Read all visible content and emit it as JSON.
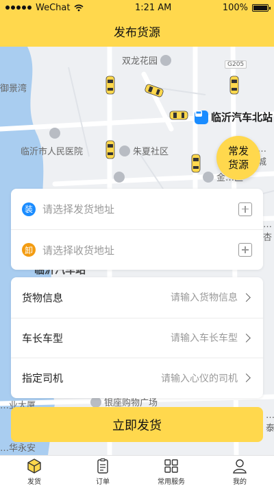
{
  "status": {
    "carrier": "WeChat",
    "time": "1:21 AM",
    "battery": "100%"
  },
  "header": {
    "title": "发布货源"
  },
  "map": {
    "pois": {
      "shuanglong": "双龙花园",
      "yujingwan": "御景湾",
      "hospital": "临沂市人民医院",
      "zhuxia": "朱夏社区",
      "jinqu": "金…区",
      "right_edge": "…城",
      "right_edge2": "…杏",
      "mall": "银座购物广场",
      "industry": "…业大厦",
      "huayongan": "…华永安",
      "tai": "…泰"
    },
    "station": "临沂汽车北站",
    "station_obscured": "临沂汽车站",
    "road": "G205"
  },
  "fab": {
    "line1": "常发",
    "line2": "货源"
  },
  "address": {
    "load_badge": "装",
    "load_placeholder": "请选择发货地址",
    "unload_badge": "卸",
    "unload_placeholder": "请选择收货地址"
  },
  "info": {
    "goods": {
      "label": "货物信息",
      "placeholder": "请输入货物信息"
    },
    "vehicle": {
      "label": "车长车型",
      "placeholder": "请输入车长车型"
    },
    "driver": {
      "label": "指定司机",
      "placeholder": "请输入心仪的司机"
    }
  },
  "submit_label": "立即发货",
  "tabs": [
    {
      "label": "发货",
      "icon": "box-icon",
      "active": true
    },
    {
      "label": "订单",
      "icon": "clipboard-icon"
    },
    {
      "label": "常用服务",
      "icon": "grid-icon"
    },
    {
      "label": "我的",
      "icon": "person-icon"
    }
  ],
  "colors": {
    "accent": "#ffd84d",
    "load_badge": "#1a8cff",
    "unload_badge": "#f39c12",
    "station_blue": "#1a8cff"
  }
}
